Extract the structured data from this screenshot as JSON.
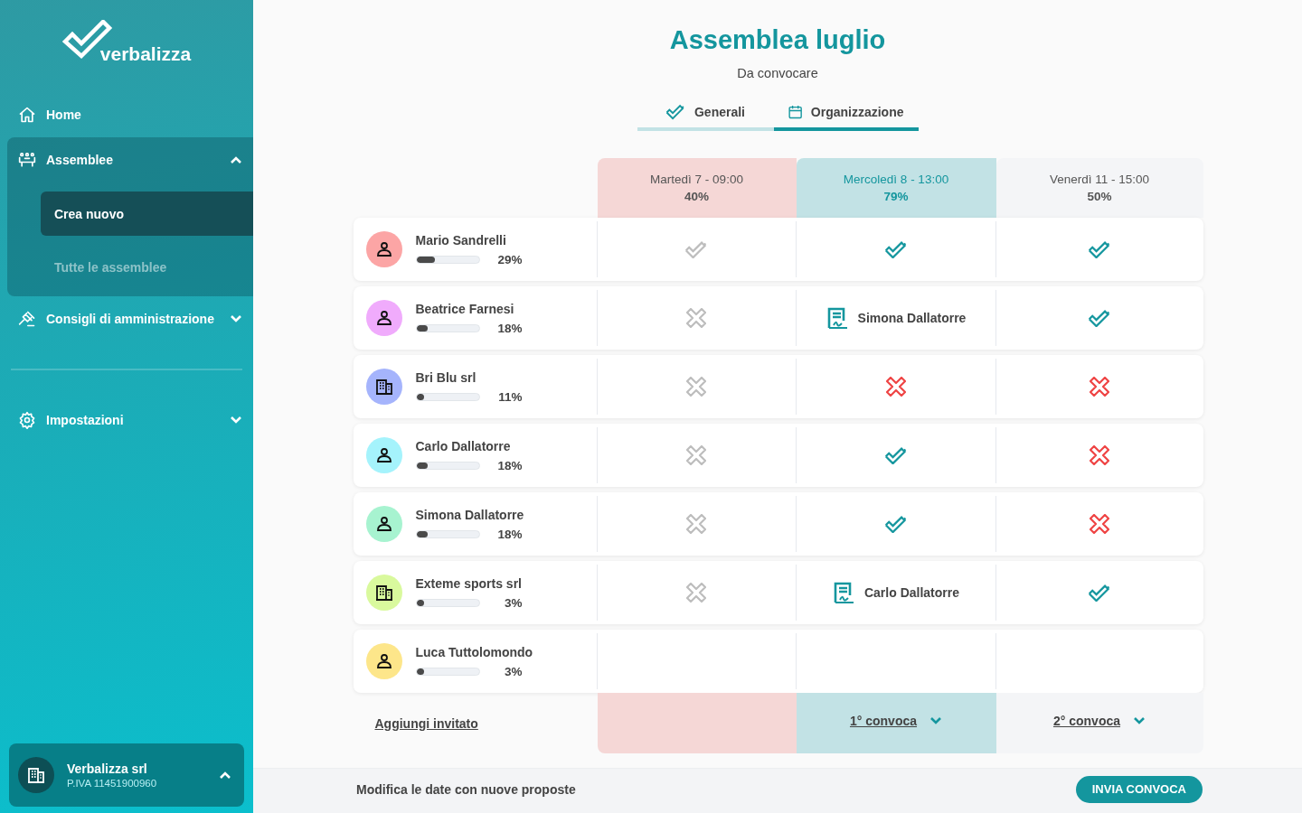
{
  "sidebar": {
    "logo": "verbalizza",
    "items": [
      {
        "label": "Home"
      },
      {
        "label": "Assemblee",
        "expanded": true,
        "children": [
          {
            "label": "Crea nuovo",
            "selected": true
          },
          {
            "label": "Tutte le assemblee",
            "selected": false
          }
        ]
      },
      {
        "label": "Consigli di amministrazione",
        "expanded": false
      }
    ],
    "settings": {
      "label": "Impostazioni",
      "expanded": false
    },
    "company": {
      "name": "Verbalizza srl",
      "vat": "P.IVA 11451900960",
      "expanded": true
    }
  },
  "header": {
    "title": "Assemblea luglio",
    "status": "Da convocare"
  },
  "tabs": [
    {
      "label": "Generali",
      "selected": false
    },
    {
      "label": "Organizzazione",
      "selected": true
    }
  ],
  "columns": [
    {
      "label": "Martedì  7 - 09:00",
      "percent": "40%",
      "color": "#f5d7d6",
      "selected": false
    },
    {
      "label": "Mercoledì 8 - 13:00",
      "percent": "79%",
      "color": "#c2e2e5",
      "selected": true,
      "footer": "1° convoca"
    },
    {
      "label": "Venerdì 11 - 15:00",
      "percent": "50%",
      "color": "#f4f5f7",
      "selected": false,
      "footer": "2° convoca"
    }
  ],
  "participants": [
    {
      "name": "Mario Sandrelli",
      "percent": "29%",
      "level": 0.29,
      "kind": "person",
      "color": "#fca5a5",
      "cells": [
        {
          "kind": "check",
          "muted": true
        },
        {
          "kind": "check",
          "muted": false
        },
        {
          "kind": "check",
          "muted": false
        }
      ]
    },
    {
      "name": "Beatrice Farnesi",
      "percent": "18%",
      "level": 0.18,
      "kind": "person",
      "color": "#f0abfc",
      "cells": [
        {
          "kind": "cross",
          "muted": true
        },
        {
          "kind": "delegate",
          "name": "Simona Dallatorre"
        },
        {
          "kind": "check",
          "muted": false
        }
      ]
    },
    {
      "name": "Bri Blu srl",
      "percent": "11%",
      "level": 0.11,
      "kind": "company",
      "color": "#a5b4fc",
      "cells": [
        {
          "kind": "cross",
          "muted": true
        },
        {
          "kind": "cross",
          "muted": false
        },
        {
          "kind": "cross",
          "muted": false
        }
      ]
    },
    {
      "name": "Carlo Dallatorre",
      "percent": "18%",
      "level": 0.18,
      "kind": "person",
      "color": "#a5f3fc",
      "cells": [
        {
          "kind": "cross",
          "muted": true
        },
        {
          "kind": "check",
          "muted": false
        },
        {
          "kind": "cross",
          "muted": false
        }
      ]
    },
    {
      "name": "Simona Dallatorre",
      "percent": "18%",
      "level": 0.18,
      "kind": "person",
      "color": "#a7f3d0",
      "cells": [
        {
          "kind": "cross",
          "muted": true
        },
        {
          "kind": "check",
          "muted": false
        },
        {
          "kind": "cross",
          "muted": false
        }
      ]
    },
    {
      "name": "Exteme sports srl",
      "percent": "3%",
      "level": 0.03,
      "kind": "company",
      "color": "#d9f99d",
      "cells": [
        {
          "kind": "cross",
          "muted": true
        },
        {
          "kind": "delegate",
          "name": "Carlo Dallatorre"
        },
        {
          "kind": "check",
          "muted": false
        }
      ]
    },
    {
      "name": "Luca Tuttolomondo",
      "percent": "3%",
      "level": 0.03,
      "kind": "person",
      "color": "#fde68a",
      "cells": [
        {
          "kind": "empty"
        },
        {
          "kind": "empty"
        },
        {
          "kind": "empty"
        }
      ]
    }
  ],
  "add_link": "Aggiungi invitato",
  "bottom": {
    "note": "Modifica le date con nuove proposte",
    "button": "INVIA CONVOCA"
  }
}
